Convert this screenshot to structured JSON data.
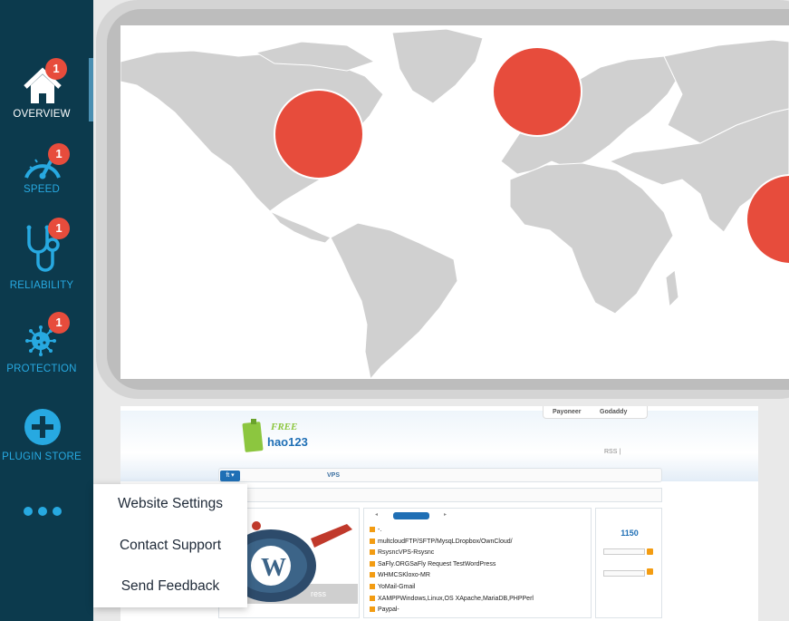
{
  "sidebar": {
    "items": [
      {
        "label": "OVERVIEW",
        "badge": "1",
        "icon": "home-icon",
        "active": true
      },
      {
        "label": "SPEED",
        "badge": "1",
        "icon": "speedometer-icon"
      },
      {
        "label": "RELIABILITY",
        "badge": "1",
        "icon": "stethoscope-icon"
      },
      {
        "label": "PROTECTION",
        "badge": "1",
        "icon": "virus-icon"
      },
      {
        "label": "PLUGIN STORE",
        "icon": "plus-circle-icon"
      }
    ],
    "more_icon": "more-dots-icon",
    "colors": {
      "background": "#0c3a4d",
      "accent": "#27a9e1",
      "badge": "#e74c3c"
    }
  },
  "more_menu": {
    "items": [
      "Website Settings",
      "Contact Support",
      "Send Feedback"
    ]
  },
  "map": {
    "markers": [
      {
        "region": "North America",
        "color": "#e74c3c"
      },
      {
        "region": "Europe",
        "color": "#e74c3c"
      },
      {
        "region": "Asia-Pacific",
        "color": "#e74c3c"
      }
    ]
  },
  "site_thumbnail": {
    "top_links": [
      "Payoneer",
      "Godaddy"
    ],
    "logo_text": "hao123",
    "logo_badge": "FREE",
    "rss_label": "RSS |",
    "nav_label": "VPS",
    "home_label": "ft ▾",
    "list_items": [
      "-.",
      "multcloudFTP/SFTP/MysqLDropbox/OwnCloud/",
      "RsysncVPS-Rsysnc",
      "SaFly.ORGSaFly Request TestWordPress",
      "WHMCSKloxo-MR",
      "YoMail-Gmail",
      "XAMPPWindows,Linux,OS XApache,MariaDB,PHPPerl",
      "Paypal-"
    ],
    "counter": "1150",
    "image_caption": "ress"
  }
}
